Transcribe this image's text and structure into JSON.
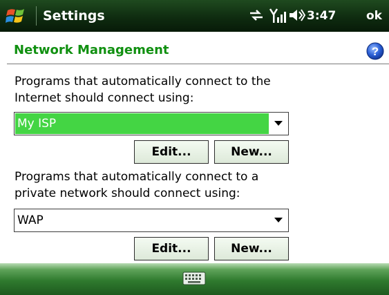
{
  "title_bar": {
    "title": "Settings",
    "time": "3:47",
    "ok_label": "ok",
    "icons": [
      "windows-start-icon",
      "connectivity-icon",
      "signal-strength-icon",
      "volume-icon"
    ]
  },
  "page": {
    "title": "Network Management",
    "help_icon": "help-icon"
  },
  "internet": {
    "description_line1": "Programs that automatically connect to the",
    "description_line2": "Internet should connect using:",
    "selected": "My ISP",
    "edit_label": "Edit...",
    "new_label": "New..."
  },
  "private": {
    "description_line1": "Programs that automatically connect to a",
    "description_line2": "private network should connect using:",
    "selected": "WAP",
    "edit_label": "Edit...",
    "new_label": "New..."
  },
  "softkey_bar": {
    "icon": "keyboard-icon"
  },
  "colors": {
    "accent_green": "#109010",
    "selection_green": "#44d544",
    "titlebar_dark": "#0f2c10"
  }
}
